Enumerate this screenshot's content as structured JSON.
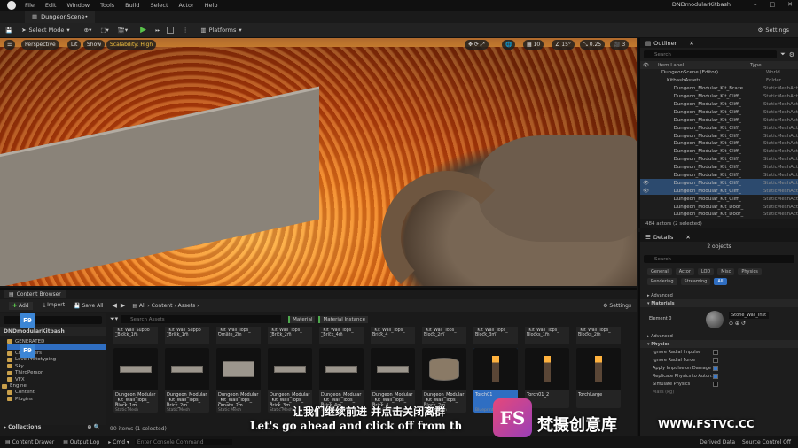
{
  "app": {
    "title": "DNDmodularKitbash",
    "menu": [
      "File",
      "Edit",
      "Window",
      "Tools",
      "Build",
      "Select",
      "Actor",
      "Help"
    ]
  },
  "tab": {
    "label": "DungeonScene•"
  },
  "toolbar": {
    "select_mode": "Select Mode",
    "platforms": "Platforms",
    "settings": "Settings"
  },
  "viewport": {
    "perspective": "Perspective",
    "lit": "Lit",
    "show": "Show",
    "scalability": "Scalability: High",
    "grid": "10",
    "angle": "15°",
    "scale": "0.25",
    "camera": "3"
  },
  "outliner": {
    "title": "Outliner",
    "search_placeholder": "Search",
    "col_label": "Item Label",
    "col_type": "Type",
    "rows": [
      {
        "label": "DungeonScene (Editor)",
        "type": "World",
        "sel": false
      },
      {
        "label": "KitbashAssets",
        "type": "Folder",
        "sel": false
      },
      {
        "label": "Dungeon_Modular_Kit_Braze",
        "type": "StaticMeshAct",
        "sel": false
      },
      {
        "label": "Dungeon_Modular_Kit_Cliff_",
        "type": "StaticMeshAct",
        "sel": false
      },
      {
        "label": "Dungeon_Modular_Kit_Cliff_",
        "type": "StaticMeshAct",
        "sel": false
      },
      {
        "label": "Dungeon_Modular_Kit_Cliff_",
        "type": "StaticMeshAct",
        "sel": false
      },
      {
        "label": "Dungeon_Modular_Kit_Cliff_",
        "type": "StaticMeshAct",
        "sel": false
      },
      {
        "label": "Dungeon_Modular_Kit_Cliff_",
        "type": "StaticMeshAct",
        "sel": false
      },
      {
        "label": "Dungeon_Modular_Kit_Cliff_",
        "type": "StaticMeshAct",
        "sel": false
      },
      {
        "label": "Dungeon_Modular_Kit_Cliff_",
        "type": "StaticMeshAct",
        "sel": false
      },
      {
        "label": "Dungeon_Modular_Kit_Cliff_",
        "type": "StaticMeshAct",
        "sel": false
      },
      {
        "label": "Dungeon_Modular_Kit_Cliff_",
        "type": "StaticMeshAct",
        "sel": false
      },
      {
        "label": "Dungeon_Modular_Kit_Cliff_",
        "type": "StaticMeshAct",
        "sel": false
      },
      {
        "label": "Dungeon_Modular_Kit_Cliff_",
        "type": "StaticMeshAct",
        "sel": false
      },
      {
        "label": "Dungeon_Modular_Kit_Cliff_",
        "type": "StaticMeshAct",
        "sel": true
      },
      {
        "label": "Dungeon_Modular_Kit_Cliff_",
        "type": "StaticMeshAct",
        "sel": true
      },
      {
        "label": "Dungeon_Modular_Kit_Cliff_",
        "type": "StaticMeshAct",
        "sel": false
      },
      {
        "label": "Dungeon_Modular_Kit_Door_",
        "type": "StaticMeshAct",
        "sel": false
      },
      {
        "label": "Dungeon_Modular_Kit_Door_",
        "type": "StaticMeshAct",
        "sel": false
      },
      {
        "label": "Dungeon_Modular_Kit_Door_",
        "type": "StaticMeshAct",
        "sel": false
      }
    ],
    "footer": "484 actors (2 selected)"
  },
  "details": {
    "title": "Details",
    "count": "2 objects",
    "search_placeholder": "Search",
    "filters": [
      "General",
      "Actor",
      "LOD",
      "Misc",
      "Physics",
      "Rendering",
      "Streaming",
      "All"
    ],
    "sections": {
      "advanced": "Advanced",
      "materials": "Materials",
      "physics": "Physics"
    },
    "element": "Element 0",
    "material": "Stone_Wall_Inst",
    "physics_rows": [
      "Ignore Radial Impulse",
      "Ignore Radial Force",
      "Apply Impulse on Damage",
      "Replicate Physics to Auton...",
      "Simulate Physics",
      "Mass (kg)"
    ]
  },
  "content_browser": {
    "tab": "Content Browser",
    "add": "Add",
    "import": "Import",
    "save_all": "Save All",
    "path": [
      "All",
      "Content",
      "Assets"
    ],
    "settings": "Settings",
    "search_placeholder": "Search Assets",
    "chips": [
      "Material",
      "Material Instance"
    ],
    "root": "DNDmodularKitbash",
    "tree": [
      "Characters",
      "LevelPrototyping",
      "Sky",
      "ThirdPerson",
      "VFX",
      "Engine",
      "Content",
      "Plugins"
    ],
    "tree_extra": [
      "GENERATED"
    ],
    "top_row": [
      "_Kit_Wall_Suppo _Block_1m",
      "_Kit_Wall_Suppo _Brick_1m",
      "_Kit_Wall_Tops_ Ornate_2m",
      "_Kit_Wall_Tops_ _Brick_2m",
      "_Kit_Wall_Tops_ _Brick_4m",
      "_Kit_Wall_Tops_ Brick_4",
      "_Kit_Wall_Tops_ Block_2m",
      "_Kit_Wall_Tops_ Block_3m",
      "_Kit_Wall_Tops_ Blocks_1m",
      "_Kit_Wall_Tops_ Blocks_2m"
    ],
    "assets": [
      {
        "label": "Dungeon_Modular _Kit_Wall_Tops_ Block_1m",
        "sub": "Static Mesh",
        "sel": false
      },
      {
        "label": "Dungeon_Modular _Kit_Wall_Tops_ Brick_2m",
        "sub": "Static Mesh",
        "sel": false
      },
      {
        "label": "Dungeon_Modular _Kit_Wall_Tops_ Ornate_2m",
        "sub": "Static Mesh",
        "sel": false
      },
      {
        "label": "Dungeon_Modular _Kit_Wall_Tops_ Brick_3m",
        "sub": "Static Mesh",
        "sel": false
      },
      {
        "label": "Dungeon_Modular _Kit_Wall_Tops_ Brick_4m",
        "sub": "Static Mesh",
        "sel": false
      },
      {
        "label": "Dungeon_Modular _Kit_Wall_Tops_ Brick_4",
        "sub": "Static Mesh",
        "sel": false
      },
      {
        "label": "Dungeon_Modular _Kit_Wall_Tops_ Block_2m",
        "sub": "Static Mesh",
        "sel": false
      },
      {
        "label": "Torch01",
        "sub": "Blueprint Class",
        "sel": true
      },
      {
        "label": "Torch01_2",
        "sub": "",
        "sel": false
      },
      {
        "label": "TorchLarge",
        "sub": "",
        "sel": false
      }
    ],
    "count": "90 items (1 selected)",
    "collections": "Collections"
  },
  "status": {
    "drawer": "Content Drawer",
    "output": "Output Log",
    "cmd": "Cmd",
    "cmd_placeholder": "Enter Console Command",
    "derived": "Derived Data",
    "source": "Source Control Off"
  },
  "overlay": {
    "key": "F9",
    "sub_zh": "让我们继续前进 并点击关闭离群",
    "sub_en": "Let's go ahead and click off from th",
    "wm_logo": "FS",
    "wm_zh": "梵摄创意库",
    "wm_url": "WWW.FSTVC.CC"
  }
}
